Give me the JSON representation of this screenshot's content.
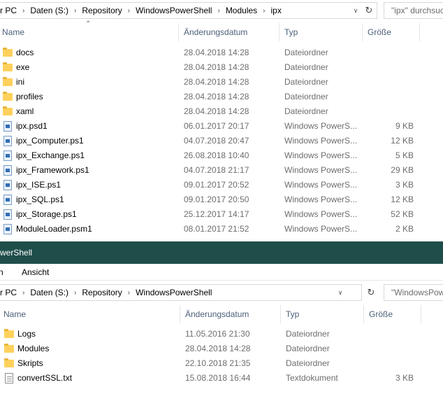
{
  "top": {
    "breadcrumb": [
      "r PC",
      "Daten (S:)",
      "Repository",
      "WindowsPowerShell",
      "Modules",
      "ipx"
    ],
    "search_placeholder": "\"ipx\" durchsuchen",
    "columns": {
      "name": "Name",
      "date": "Änderungsdatum",
      "type": "Typ",
      "size": "Größe"
    },
    "files": [
      {
        "name": "docs",
        "date": "28.04.2018 14:28",
        "type": "Dateiordner",
        "size": "",
        "icon": "folder-icon"
      },
      {
        "name": "exe",
        "date": "28.04.2018 14:28",
        "type": "Dateiordner",
        "size": "",
        "icon": "folder-icon"
      },
      {
        "name": "ini",
        "date": "28.04.2018 14:28",
        "type": "Dateiordner",
        "size": "",
        "icon": "folder-icon"
      },
      {
        "name": "profiles",
        "date": "28.04.2018 14:28",
        "type": "Dateiordner",
        "size": "",
        "icon": "folder-icon"
      },
      {
        "name": "xaml",
        "date": "28.04.2018 14:28",
        "type": "Dateiordner",
        "size": "",
        "icon": "folder-icon"
      },
      {
        "name": "ipx.psd1",
        "date": "06.01.2017 20:17",
        "type": "Windows PowerS...",
        "size": "9 KB",
        "icon": "powershell-data-file-icon"
      },
      {
        "name": "ipx_Computer.ps1",
        "date": "04.07.2018 20:47",
        "type": "Windows PowerS...",
        "size": "12 KB",
        "icon": "powershell-script-icon"
      },
      {
        "name": "ipx_Exchange.ps1",
        "date": "26.08.2018 10:40",
        "type": "Windows PowerS...",
        "size": "5 KB",
        "icon": "powershell-script-icon"
      },
      {
        "name": "ipx_Framework.ps1",
        "date": "04.07.2018 21:17",
        "type": "Windows PowerS...",
        "size": "29 KB",
        "icon": "powershell-script-icon"
      },
      {
        "name": "ipx_ISE.ps1",
        "date": "09.01.2017 20:52",
        "type": "Windows PowerS...",
        "size": "3 KB",
        "icon": "powershell-script-icon"
      },
      {
        "name": "ipx_SQL.ps1",
        "date": "09.01.2017 20:50",
        "type": "Windows PowerS...",
        "size": "12 KB",
        "icon": "powershell-script-icon"
      },
      {
        "name": "ipx_Storage.ps1",
        "date": "25.12.2017 14:17",
        "type": "Windows PowerS...",
        "size": "52 KB",
        "icon": "powershell-script-icon"
      },
      {
        "name": "ModuleLoader.psm1",
        "date": "08.01.2017 21:52",
        "type": "Windows PowerS...",
        "size": "2 KB",
        "icon": "powershell-module-icon"
      }
    ]
  },
  "bottom": {
    "window_title": "werShell",
    "ribbon_tabs": [
      "n",
      "Ansicht"
    ],
    "breadcrumb": [
      "r PC",
      "Daten (S:)",
      "Repository",
      "WindowsPowerShell"
    ],
    "search_placeholder": "\"WindowsPow",
    "columns": {
      "name": "Name",
      "date": "Änderungsdatum",
      "type": "Typ",
      "size": "Größe"
    },
    "files": [
      {
        "name": "Logs",
        "date": "11.05.2016 21:30",
        "type": "Dateiordner",
        "size": "",
        "icon": "folder-icon"
      },
      {
        "name": "Modules",
        "date": "28.04.2018 14:28",
        "type": "Dateiordner",
        "size": "",
        "icon": "folder-icon"
      },
      {
        "name": "Skripts",
        "date": "22.10.2018 21:35",
        "type": "Dateiordner",
        "size": "",
        "icon": "folder-icon"
      },
      {
        "name": "convertSSL.txt",
        "date": "15.08.2018 16:44",
        "type": "Textdokument",
        "size": "3 KB",
        "icon": "text-file-icon"
      }
    ]
  }
}
